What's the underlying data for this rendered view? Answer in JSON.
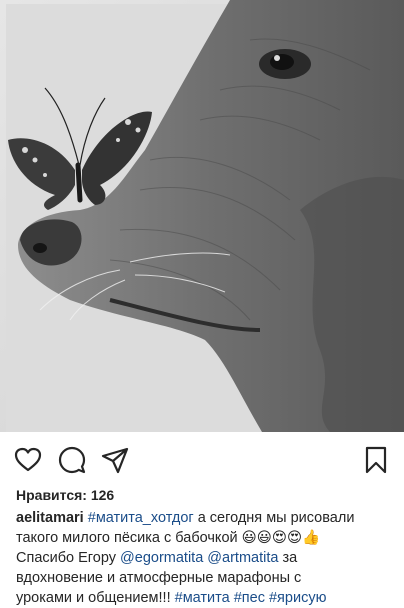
{
  "post": {
    "likes_label": "Нравится: 126",
    "caption": {
      "username": "aelitamari",
      "line1_tag": "#матита_хотдог",
      "line1_text": " а сегодня мы рисовали",
      "line2_text": "такого милого пёсика с бабочкой ",
      "line2_emojis": "😃😃😍😍👍",
      "line3_text": "Спасибо Егору ",
      "line3_mention1": "@egormatita",
      "line3_mention2": "@artmatita",
      "line3_tail": " за",
      "line4_text": "вдохновение и атмосферные марафоны с",
      "line5_text": "уроками и общением!!! ",
      "line5_tag1": "#матита",
      "line5_tag2": "#пес",
      "line5_tag3": "#ярисую"
    }
  },
  "icons": {
    "like": "heart-outline",
    "comment": "speech-bubble",
    "share": "paper-plane",
    "save": "bookmark"
  }
}
